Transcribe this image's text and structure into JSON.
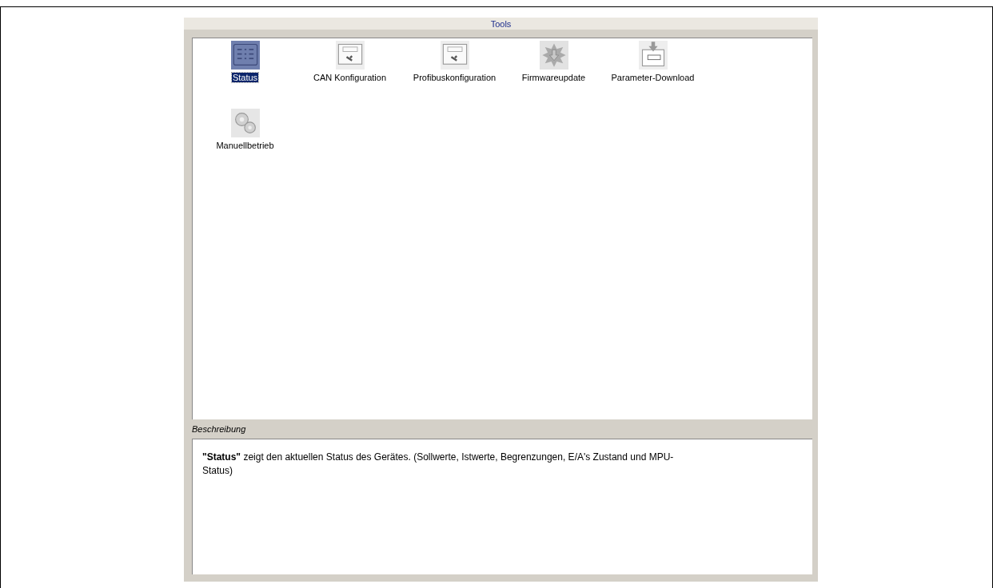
{
  "panel": {
    "title": "Tools"
  },
  "tools": [
    {
      "label": "Status",
      "kind": "status",
      "selected": true
    },
    {
      "label": "CAN Konfiguration",
      "kind": "can",
      "selected": false
    },
    {
      "label": "Profibuskonfiguration",
      "kind": "pb",
      "selected": false
    },
    {
      "label": "Firmwareupdate",
      "kind": "firmware",
      "selected": false
    },
    {
      "label": "Parameter-Download",
      "kind": "download",
      "selected": false
    },
    {
      "label": "Manuellbetrieb",
      "kind": "gears",
      "selected": false
    }
  ],
  "description": {
    "heading": "Beschreibung",
    "text": "**\"Status\"** zeigt den aktuellen Status des Gerätes. (Sollwerte, Istwerte, Begrenzungen, E/A's Zustand und MPU-Status)"
  }
}
